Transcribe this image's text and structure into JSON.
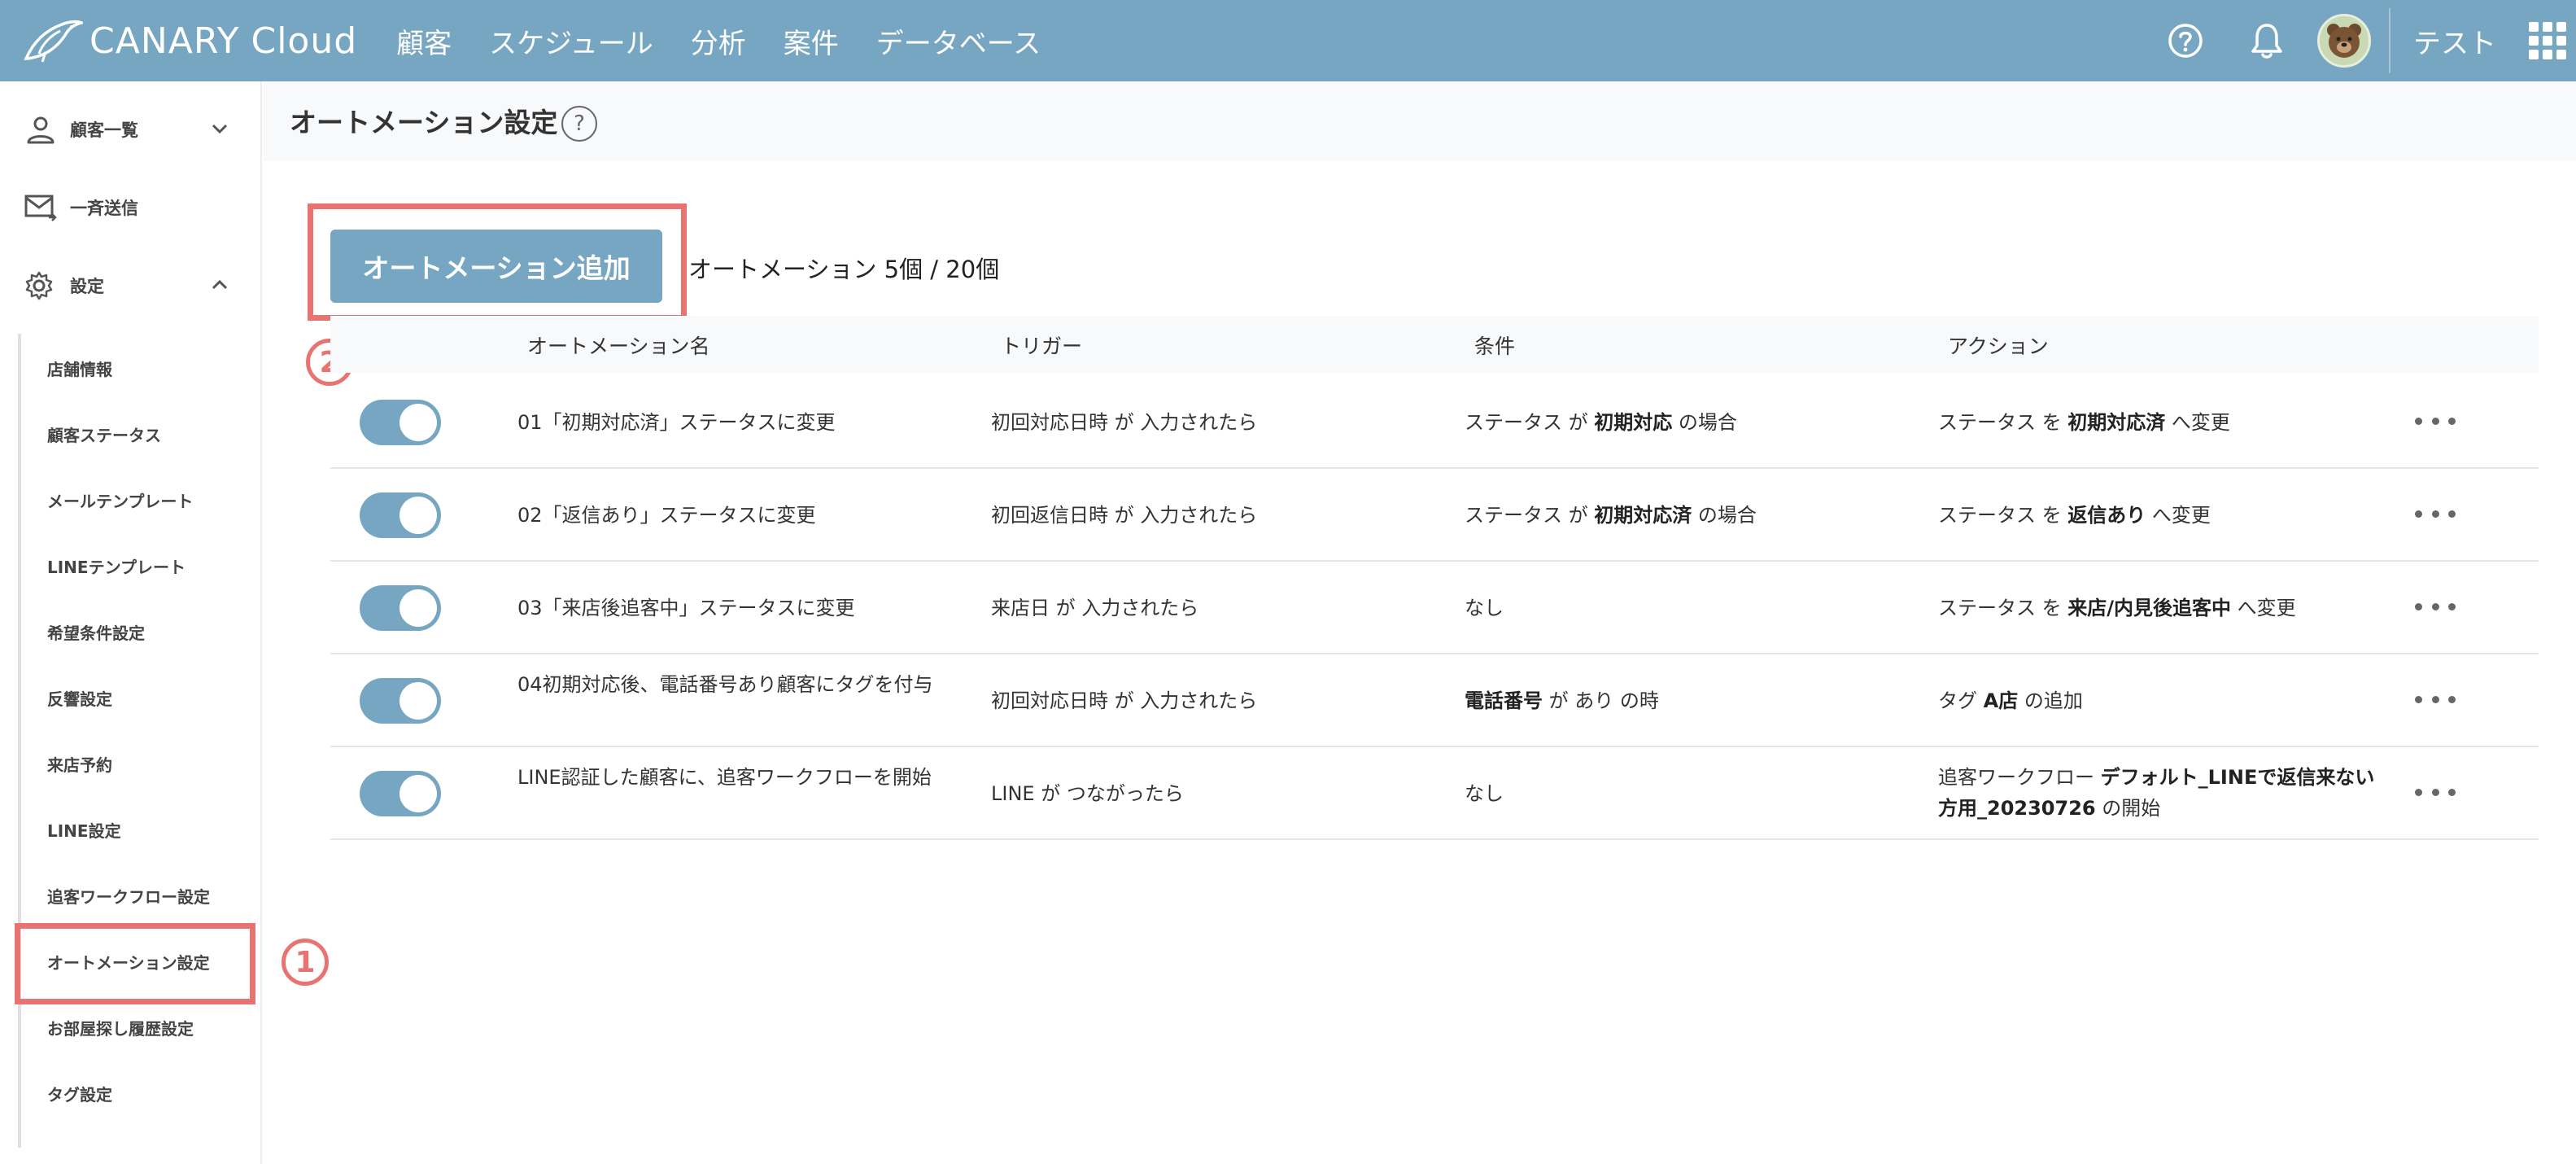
{
  "header": {
    "brand": "CANARY",
    "brand_suffix": "Cloud",
    "nav": [
      "顧客",
      "スケジュール",
      "分析",
      "案件",
      "データベース"
    ],
    "user_name": "テスト"
  },
  "sidebar": {
    "customers": "顧客一覧",
    "broadcast": "一斉送信",
    "settings": "設定",
    "sub_items": [
      "店舗情報",
      "顧客ステータス",
      "メールテンプレート",
      "LINEテンプレート",
      "希望条件設定",
      "反響設定",
      "来店予約",
      "LINE設定",
      "追客ワークフロー設定",
      "オートメーション設定",
      "お部屋探し履歴設定",
      "タグ設定"
    ]
  },
  "page": {
    "title": "オートメーション設定",
    "help": "?",
    "add_button": "オートメーション追加",
    "count": "オートメーション 5個 / 20個",
    "marker1": "1",
    "marker2": "2"
  },
  "table": {
    "headers": [
      "オートメーション名",
      "トリガー",
      "条件",
      "アクション"
    ],
    "rows": [
      {
        "name": "01「初期対応済」ステータスに変更",
        "trigger": "初回対応日時 が 入力されたら",
        "cond_pre": "ステータス が ",
        "cond_bold": "初期対応",
        "cond_post": " の場合",
        "act_pre": "ステータス を ",
        "act_bold": "初期対応済",
        "act_post": " へ変更",
        "enabled": true
      },
      {
        "name": "02「返信あり」ステータスに変更",
        "trigger": "初回返信日時 が 入力されたら",
        "cond_pre": "ステータス が ",
        "cond_bold": "初期対応済",
        "cond_post": " の場合",
        "act_pre": "ステータス を ",
        "act_bold": "返信あり",
        "act_post": " へ変更",
        "enabled": true
      },
      {
        "name": "03「来店後追客中」ステータスに変更",
        "trigger": "来店日 が 入力されたら",
        "cond_pre": "なし",
        "cond_bold": "",
        "cond_post": "",
        "act_pre": "ステータス を ",
        "act_bold": "来店/内見後追客中",
        "act_post": " へ変更",
        "enabled": true
      },
      {
        "name": "04初期対応後、電話番号あり顧客にタグを付与",
        "trigger": "初回対応日時 が 入力されたら",
        "cond_pre": "",
        "cond_bold": "電話番号",
        "cond_post": " が あり の時",
        "act_pre": "タグ ",
        "act_bold": "A店",
        "act_post": " の追加",
        "enabled": true
      },
      {
        "name": "LINE認証した顧客に、追客ワークフローを開始",
        "trigger": "LINE が つながったら",
        "cond_pre": "なし",
        "cond_bold": "",
        "cond_post": "",
        "act_pre": "追客ワークフロー ",
        "act_bold": "デフォルト_LINEで返信来ない方用_20230726",
        "act_post": " の開始",
        "enabled": true
      }
    ]
  }
}
